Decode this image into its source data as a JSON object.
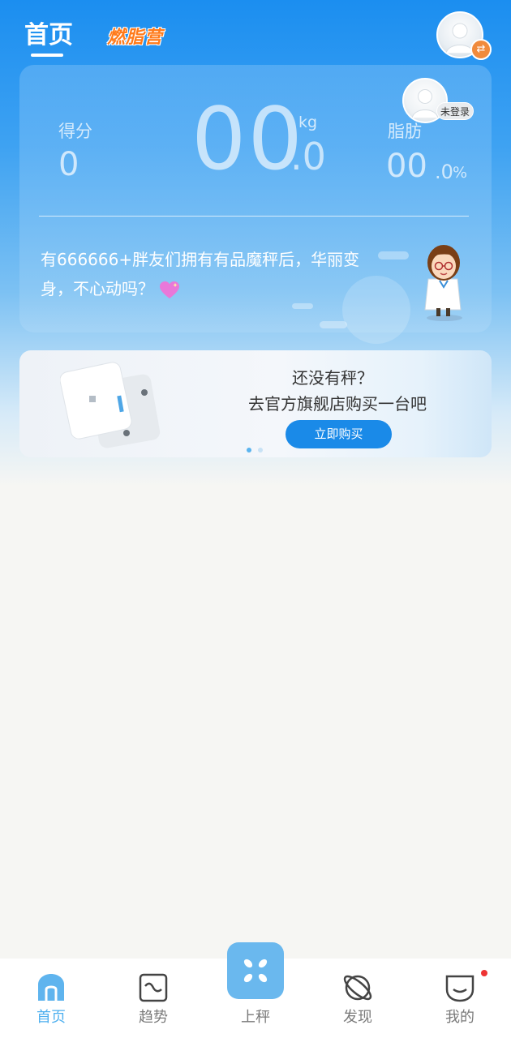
{
  "topnav": {
    "tab_home": "首页",
    "tab_burn": "燃脂营"
  },
  "stats": {
    "score_label": "得分",
    "score_value": "0",
    "weight_integer": "00",
    "weight_decimal": ".0",
    "weight_unit": "kg",
    "fat_label": "脂肪",
    "fat_integer": "00",
    "fat_decimal": ".0",
    "fat_unit": "%",
    "login_status": "未登录"
  },
  "promo": {
    "text": "有666666+胖友们拥有有品魔秤后，华丽变身，不心动吗？"
  },
  "banner": {
    "line1": "还没有秤？",
    "line2": "去官方旗舰店购买一台吧",
    "button": "立即购买"
  },
  "bottom_nav": {
    "items": [
      {
        "label": "首页",
        "icon": "home-icon",
        "active": true
      },
      {
        "label": "趋势",
        "icon": "trend-icon",
        "active": false
      },
      {
        "label": "上秤",
        "icon": "scale-icon",
        "active": false
      },
      {
        "label": "发现",
        "icon": "planet-icon",
        "active": false
      },
      {
        "label": "我的",
        "icon": "profile-icon",
        "active": false
      }
    ]
  },
  "colors": {
    "primary": "#1a8ae8",
    "active_tab": "#4fb0ef",
    "accent_orange": "#ff7a1a",
    "notification": "#ee3333"
  }
}
